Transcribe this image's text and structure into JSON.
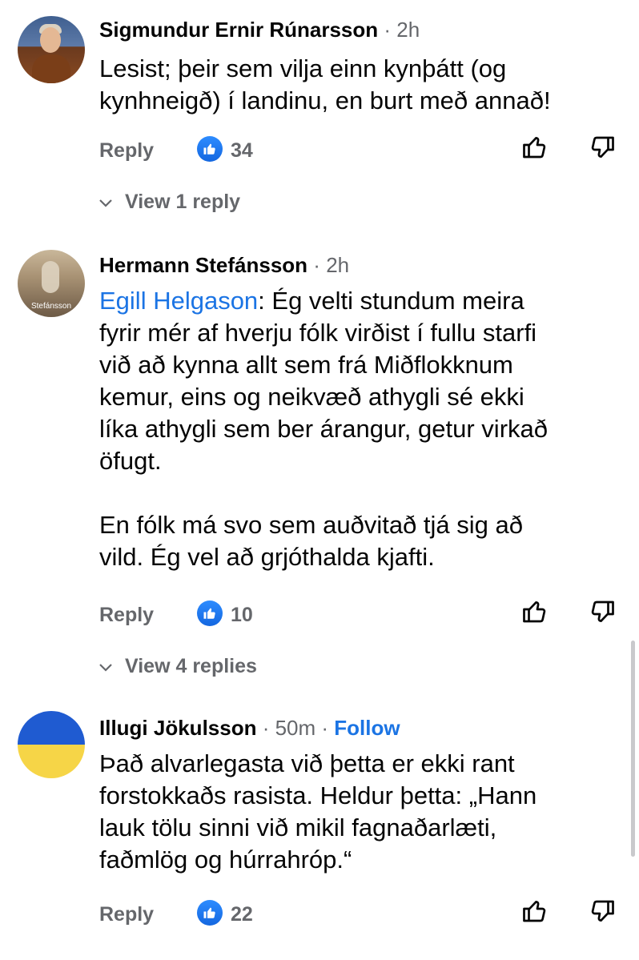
{
  "comments": [
    {
      "name": "Sigmundur Ernir Rúnarsson",
      "time": "2h",
      "body_lines": [
        "Lesist; þeir sem vilja einn kynþátt (og",
        "kynhneigð) í landinu, en burt með annað!"
      ],
      "reply_label": "Reply",
      "like_count": "34",
      "view_replies": "View 1 reply"
    },
    {
      "name": "Hermann Stefánsson",
      "time": "2h",
      "avatar_caption": "Stefánsson",
      "mention": "Egill Helgason",
      "body_lines": [
        ": Ég velti stundum meira",
        "fyrir mér af hverju fólk virðist í fullu starfi",
        "við að kynna allt sem frá Miðflokknum",
        "kemur, eins og neikvæð athygli sé ekki",
        "líka athygli sem ber árangur, getur virkað",
        "öfugt.",
        "",
        "En fólk má svo sem auðvitað tjá sig að",
        "vild. Ég vel að grjóthalda kjafti."
      ],
      "reply_label": "Reply",
      "like_count": "10",
      "view_replies": "View 4 replies"
    },
    {
      "name": "Illugi Jökulsson",
      "time": "50m",
      "follow": "Follow",
      "body_lines": [
        "Það alvarlegasta við þetta er ekki rant",
        "forstokkaðs rasista. Heldur þetta: „Hann",
        "lauk tölu sinni við mikil fagnaðarlæti,",
        "faðmlög og húrrahróp.“"
      ],
      "reply_label": "Reply",
      "like_count": "22"
    }
  ],
  "colors": {
    "accent": "#1b74e4",
    "muted": "#65676b",
    "text": "#050505"
  },
  "separator": " · "
}
